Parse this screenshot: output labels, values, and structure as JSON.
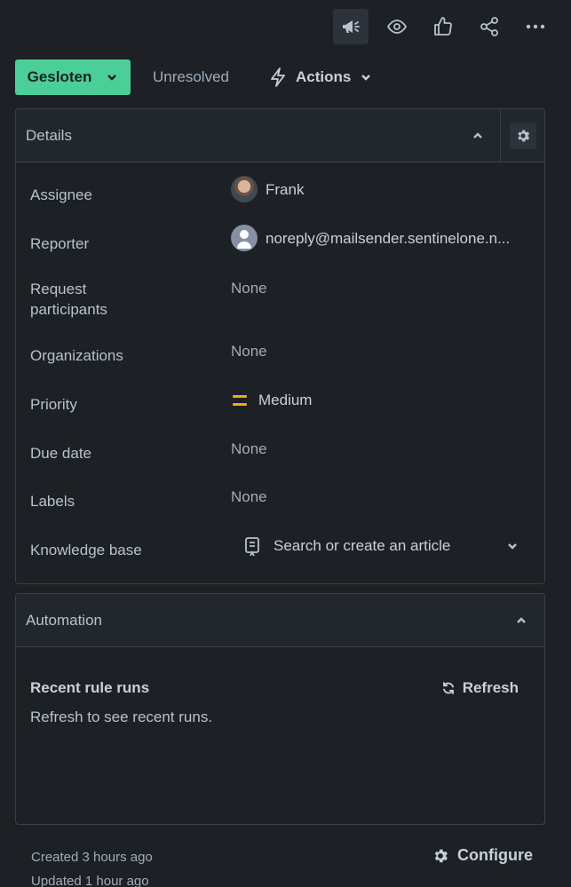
{
  "toolbar": {
    "icons": [
      "megaphone-icon",
      "eye-icon",
      "thumbs-up-icon",
      "share-icon",
      "more-icon"
    ]
  },
  "status": {
    "current": "Gesloten",
    "resolution": "Unresolved",
    "actions_label": "Actions",
    "accent": "#4bce97"
  },
  "details": {
    "title": "Details",
    "fields": {
      "assignee": {
        "label": "Assignee",
        "value": "Frank"
      },
      "reporter": {
        "label": "Reporter",
        "value": "noreply@mailsender.sentinelone.n..."
      },
      "request_participants": {
        "label_line1": "Request",
        "label_line2": "participants",
        "value": "None"
      },
      "organizations": {
        "label": "Organizations",
        "value": "None"
      },
      "priority": {
        "label": "Priority",
        "value": "Medium",
        "color": "#f5a623"
      },
      "due_date": {
        "label": "Due date",
        "value": "None"
      },
      "labels": {
        "label": "Labels",
        "value": "None"
      },
      "knowledge_base": {
        "label": "Knowledge base",
        "placeholder": "Search or create an article"
      }
    }
  },
  "automation": {
    "title": "Automation",
    "recent_title": "Recent rule runs",
    "refresh_label": "Refresh",
    "recent_sub": "Refresh to see recent runs."
  },
  "footer": {
    "created": "Created 3 hours ago",
    "updated": "Updated 1 hour ago",
    "configure_label": "Configure"
  }
}
